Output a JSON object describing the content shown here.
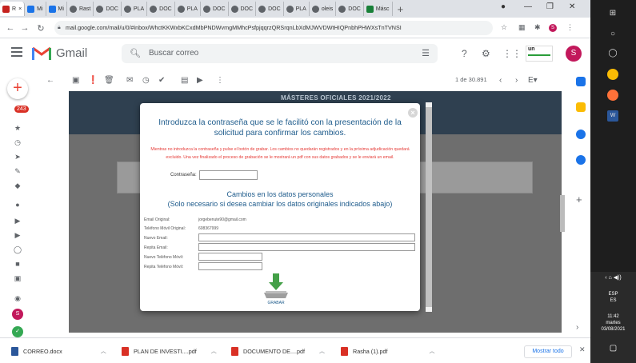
{
  "browser": {
    "tabs": [
      {
        "label": "R",
        "color": "#c5221f"
      },
      {
        "label": "Mi",
        "color": "#1a73e8"
      },
      {
        "label": "Mi",
        "color": "#1a73e8"
      },
      {
        "label": "Rast",
        "color": "#5f6368"
      },
      {
        "label": "DOC",
        "color": "#5f6368"
      },
      {
        "label": "PLA",
        "color": "#5f6368"
      },
      {
        "label": "DOC",
        "color": "#5f6368"
      },
      {
        "label": "PLA",
        "color": "#5f6368"
      },
      {
        "label": "DOC",
        "color": "#5f6368"
      },
      {
        "label": "DOC",
        "color": "#5f6368"
      },
      {
        "label": "DOC",
        "color": "#5f6368"
      },
      {
        "label": "PLA",
        "color": "#5f6368"
      },
      {
        "label": "oleis",
        "color": "#5f6368"
      },
      {
        "label": "DOC",
        "color": "#5f6368"
      },
      {
        "label": "Másc",
        "color": "#188038"
      }
    ],
    "url": "mail.google.com/mail/u/0/#inbox/WhctKKWxbKCxdMbPNDWvmgMMhcPsfpjqqrzQRSrqnLbXdMJWVDWtHIQPnbhPHWXsTnTVNSI"
  },
  "gmail": {
    "logo_text": "Gmail",
    "search_placeholder": "Buscar correo",
    "avatar_letter": "S",
    "unread_count": "243",
    "pager": "1 de 30.891",
    "uni_logo_text": "un"
  },
  "background_email": {
    "banner_text": "MÁSTERES OFICIALES 2021/2022"
  },
  "modal": {
    "heading": "Introduzca la contraseña que se le facilitó con la presentación de la solicitud para confirmar los cambios.",
    "warning": "Mientras no introduzca la contraseña y pulse el botón de grabar. Los cambios no quedarán registrados y en la próxima adjudicación quedará excluido. Una vez finalizado el proceso de grabación se le mostrará un pdf con sus datos grabados y se le enviará un email.",
    "password_label": "Contraseña:",
    "personal_title": "Cambios en los datos personales\n(Solo necesario si desea cambiar los datos originales indicados abajo)",
    "fields": {
      "email_original_label": "Email Original:",
      "email_original_value": "jorgebenute90@gmail.com",
      "phone_original_label": "Teléfono Móvil Original:",
      "phone_original_value": "608367999",
      "new_email_label": "Nuevo Email:",
      "repeat_email_label": "Repita Email:",
      "new_phone_label": "Nuevo Teléfono Móvil:",
      "repeat_phone_label": "Repita Teléfono Móvil:"
    },
    "save_label": "GRABAR"
  },
  "downloads": {
    "items": [
      {
        "name": "CORREO.docx",
        "color": "#2b579a"
      },
      {
        "name": "PLAN DE INVESTI....pdf",
        "color": "#d93025"
      },
      {
        "name": "DOCUMENTO DE....pdf",
        "color": "#d93025"
      },
      {
        "name": "Rasha (1).pdf",
        "color": "#d93025"
      }
    ],
    "show_all": "Mostrar todo"
  },
  "taskbar": {
    "lang": "ESP",
    "region": "ES",
    "time": "11:42",
    "day": "martes",
    "date": "03/08/2021"
  }
}
